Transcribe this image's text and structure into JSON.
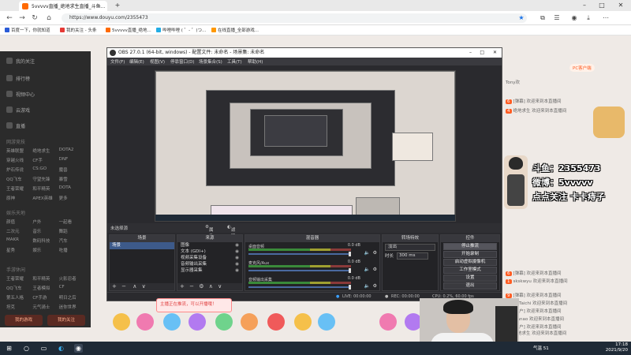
{
  "browser": {
    "tab_title": "5vvvvv直播_绝地求生直播_斗鱼...",
    "url": "https://www.douyu.com/2355473",
    "bookmarks": [
      "百度一下，你就知道",
      "我的关注 - 头条",
      "5vvvvv直播_绝地...",
      "哔哩哔哩 ( ゜- ゜)つ...",
      "在线直播_全部游戏..."
    ]
  },
  "douyu_sidebar": {
    "nav_items": [
      "我的关注",
      "排行榜",
      "视频中心",
      "云游戏",
      "直播"
    ],
    "sections": [
      {
        "title": "网游竞技",
        "items": [
          "英雄联盟",
          "绝地求生",
          "DOTA2",
          "穿越火线",
          "CF手",
          "DNF",
          "炉石传说",
          "CS:GO",
          "魔兽",
          "QQ飞车",
          "守望先锋",
          "暴雪",
          "王者荣耀",
          "和平精英",
          "DOTA",
          "原神",
          "APEX英雄",
          "更多"
        ]
      },
      {
        "title": "娱乐天地",
        "items": [
          "颜值",
          "户外",
          "一起看",
          "二次元",
          "音乐",
          "舞蹈",
          "MAKR",
          "数码科技",
          "汽车",
          "星秀",
          "娱乐",
          "吃播"
        ]
      },
      {
        "title": "手游休闲",
        "items": [
          "王者荣耀",
          "和平精英",
          "火影忍者",
          "QQ飞车",
          "王者模拟",
          "CF",
          "第五人格",
          "CF手游",
          "明日之后",
          "坦克",
          "元气骑士",
          "迷你世界"
        ]
      }
    ],
    "button_left": "我的游戏",
    "button_right": "我的关注"
  },
  "chat": {
    "lines": [
      "Tony欢",
      "[弹幕] 欢迎来到本直播间",
      "绝地求生 欢迎来到本直播间",
      "[弹幕] 欢迎来到本直播间",
      "BBTaichi 欢迎来到本直播间",
      "[用户] 欢迎来到本直播间",
      "nJanao 欢迎来到本直播间",
      "[用户] 欢迎来到本直播间",
      "绝地求生 欢迎来到本直播间",
      "skskwyu 欢迎来到本直播间",
      "[弹幕] 欢迎来到本直播间"
    ],
    "pc_client": "PC客户端"
  },
  "streamer_card": {
    "line1": "斗鱼：2355473",
    "line2": "微博：5vvvvv",
    "line3": "点点关注 卡卡痔子"
  },
  "obs": {
    "title": "OBS 27.0.1 (64-bit, windows) - 配置文件: 未命名 - 场景集: 未命名",
    "menu": [
      "文件(F)",
      "编辑(E)",
      "视图(V)",
      "停靠窗口(D)",
      "场景集合(S)",
      "工具(T)",
      "帮助(H)"
    ],
    "selection_label": "未选择源",
    "properties_btn": "属性",
    "filters_btn": "滤镜",
    "scenes": {
      "header": "场景",
      "items": [
        "场景"
      ]
    },
    "sources": {
      "header": "来源",
      "items": [
        "图像",
        "文本 (GDI+)",
        "视频采集设备",
        "音频输出采集",
        "显示器采集"
      ]
    },
    "mixer": {
      "header": "混音器",
      "channels": [
        {
          "name": "桌面音频",
          "db": "0.0 dB"
        },
        {
          "name": "麦克风/Aux",
          "db": "0.0 dB"
        },
        {
          "name": "音频输出采集",
          "db": "0.0 dB"
        }
      ]
    },
    "transitions": {
      "header": "转场特效",
      "type": "淡出",
      "duration_label": "时长",
      "duration": "300 ms"
    },
    "controls": {
      "header": "控件",
      "buttons": [
        "停止推流",
        "开始录制",
        "启动虚拟摄像机",
        "工作室模式",
        "设置",
        "退出"
      ]
    },
    "status": {
      "live": "LIVE: 00:00:00",
      "rec": "REC: 00:00:00",
      "cpu": "CPU: 0.2%, 60.00 fps",
      "fps": "60.00 fps"
    }
  },
  "popup_notice": "主播正在推流，可以开播哦！",
  "taskbar": {
    "weather": "气温 51",
    "time": "17:18",
    "date": "2021/9/20"
  },
  "colors": {
    "obs_bg": "#2a2a2e",
    "douyu_orange": "#ff5d23",
    "taskbar": "#1f2a36"
  }
}
